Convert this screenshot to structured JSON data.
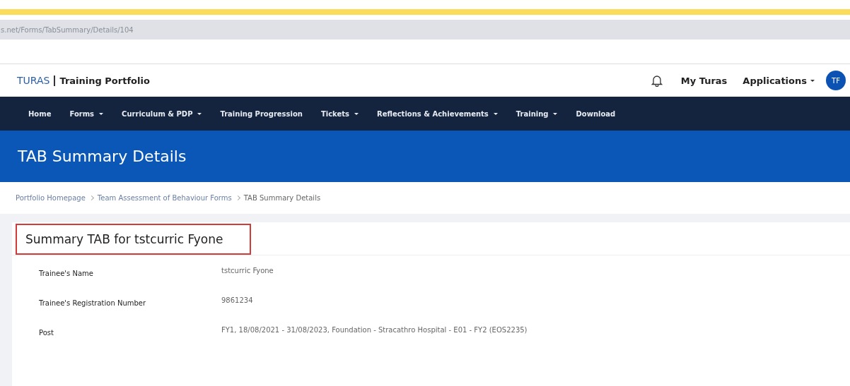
{
  "browser": {
    "url": "s.net/Forms/TabSummary/Details/104"
  },
  "header": {
    "brand": "TURAS",
    "product": "Training Portfolio",
    "links": [
      {
        "label": "My Turas",
        "has_menu": false
      },
      {
        "label": "Applications",
        "has_menu": true
      }
    ],
    "avatar": "TF"
  },
  "nav": [
    {
      "label": "Home",
      "has_menu": false
    },
    {
      "label": "Forms",
      "has_menu": true
    },
    {
      "label": "Curriculum & PDP",
      "has_menu": true
    },
    {
      "label": "Training Progression",
      "has_menu": false
    },
    {
      "label": "Tickets",
      "has_menu": true
    },
    {
      "label": "Reflections & Achievements",
      "has_menu": true
    },
    {
      "label": "Training",
      "has_menu": true
    },
    {
      "label": "Download",
      "has_menu": false
    }
  ],
  "page_title": "TAB Summary Details",
  "breadcrumb": [
    {
      "label": "Portfolio Homepage",
      "link": true
    },
    {
      "label": "Team Assessment of Behaviour Forms",
      "link": true
    },
    {
      "label": "TAB Summary Details",
      "link": false
    }
  ],
  "card": {
    "title": "Summary TAB for tstcurric Fyone",
    "highlighted": true,
    "fields": [
      {
        "label": "Trainee's Name",
        "value": "tstcurric Fyone"
      },
      {
        "label": "Trainee's Registration Number",
        "value": "9861234"
      },
      {
        "label": "Post",
        "value": "FY1, 18/08/2021 - 31/08/2023, Foundation - Stracathro Hospital - E01 - FY2 (EOS2235)"
      }
    ]
  }
}
